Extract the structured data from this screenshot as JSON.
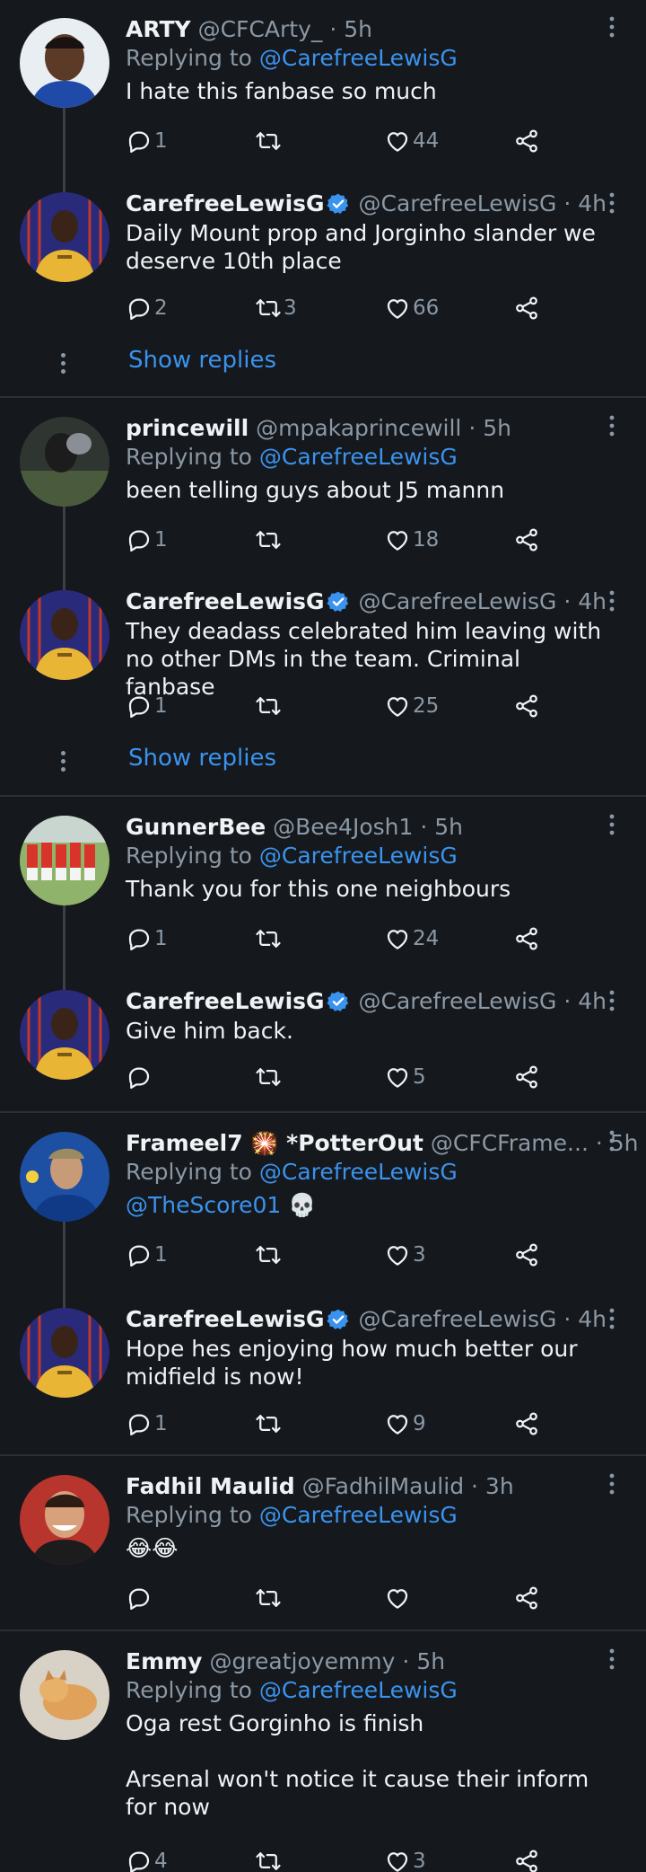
{
  "colors": {
    "background": "#15181c",
    "text": "#f0f3f5",
    "muted": "#8b98a5",
    "accent": "#3a93ee",
    "divider": "#2b3036"
  },
  "icons": {
    "reply": "reply-icon",
    "retweet": "retweet-icon",
    "like": "like-icon",
    "share": "share-icon",
    "more": "more-icon",
    "verified": "verified-badge-icon"
  },
  "show_replies_label": "Show replies",
  "replying_prefix": "Replying to",
  "tweets": [
    {
      "name": "ARTY",
      "handle": "@CFCArty_",
      "time": "· 5h",
      "reply_to": "@CarefreeLewisG",
      "text": "I hate this fanbase so much",
      "replies": "1",
      "retweets": "",
      "likes": "44"
    },
    {
      "name": "CarefreeLewisG",
      "handle": "@CarefreeLewisG",
      "time": "· 4h",
      "reply_to": "",
      "text": "Daily Mount prop and Jorginho slander we\ndeserve 10th place",
      "replies": "2",
      "retweets": "3",
      "likes": "66"
    },
    {
      "name": "princewill",
      "handle": "@mpakaprincewill",
      "time": "· 5h",
      "reply_to": "@CarefreeLewisG",
      "text": "been telling guys about J5 mannn",
      "replies": "1",
      "retweets": "",
      "likes": "18"
    },
    {
      "name": "CarefreeLewisG",
      "handle": "@CarefreeLewisG",
      "time": "· 4h",
      "reply_to": "",
      "text": "They deadass celebrated him leaving with\nno other DMs in the team. Criminal fanbase",
      "replies": "1",
      "retweets": "",
      "likes": "25"
    },
    {
      "name": "GunnerBee",
      "handle": "@Bee4Josh1",
      "time": "· 5h",
      "reply_to": "@CarefreeLewisG",
      "text": "Thank you for this one neighbours",
      "replies": "1",
      "retweets": "",
      "likes": "24"
    },
    {
      "name": "CarefreeLewisG",
      "handle": "@CarefreeLewisG",
      "time": "· 4h",
      "reply_to": "",
      "text": "Give him back.",
      "replies": "",
      "retweets": "",
      "likes": "5"
    },
    {
      "name": "Frameel7 🎇 *PotterOut",
      "handle": "@CFCFrame...",
      "time": "· 5h",
      "reply_to": "@CarefreeLewisG",
      "mention2": "@TheScore01",
      "emoji": "💀",
      "text": "",
      "replies": "1",
      "retweets": "",
      "likes": "3"
    },
    {
      "name": "CarefreeLewisG",
      "handle": "@CarefreeLewisG",
      "time": "· 4h",
      "reply_to": "",
      "text": "Hope hes enjoying how much better our\nmidfield is now!",
      "replies": "1",
      "retweets": "",
      "likes": "9"
    },
    {
      "name": "Fadhil Maulid",
      "handle": "@FadhilMaulid",
      "time": "· 3h",
      "reply_to": "@CarefreeLewisG",
      "text": "😂😂",
      "replies": "",
      "retweets": "",
      "likes": ""
    },
    {
      "name": "Emmy",
      "handle": "@greatjoyemmy",
      "time": "· 5h",
      "reply_to": "@CarefreeLewisG",
      "text": "Oga rest Gorginho is finish\n\nArsenal won't notice it cause their inform\nfor now",
      "replies": "4",
      "retweets": "",
      "likes": "3"
    }
  ]
}
